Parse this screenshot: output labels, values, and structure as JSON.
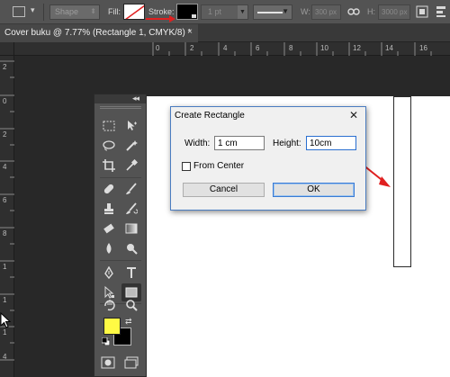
{
  "options_bar": {
    "shape_mode": "Shape",
    "fill_label": "Fill:",
    "stroke_label": "Stroke:",
    "stroke_width": "1 pt",
    "width_label": "W:",
    "width_value": "300 px",
    "height_label": "H:",
    "height_value": "3000 px",
    "stroke_color": "#000000",
    "annotation_color": "#e02020"
  },
  "document": {
    "tab_title": "Cover buku @ 7.77% (Rectangle 1, CMYK/8) *",
    "close_glyph": "×"
  },
  "rulers": {
    "horizontal": [
      "0",
      "2",
      "4",
      "6",
      "8",
      "10",
      "12",
      "14",
      "16"
    ],
    "vertical": [
      "2",
      "0",
      "2",
      "4",
      "6",
      "8",
      "1",
      "1",
      "1",
      "4"
    ]
  },
  "toolbox": {
    "foreground_color": "#fffa44",
    "background_color": "#000000"
  },
  "dialog": {
    "title": "Create Rectangle",
    "close_glyph": "✕",
    "width_label": "Width:",
    "width_value": "1 cm",
    "height_label": "Height:",
    "height_value": "10cm",
    "from_center_label": "From Center",
    "from_center_checked": false,
    "cancel_label": "Cancel",
    "ok_label": "OK"
  }
}
